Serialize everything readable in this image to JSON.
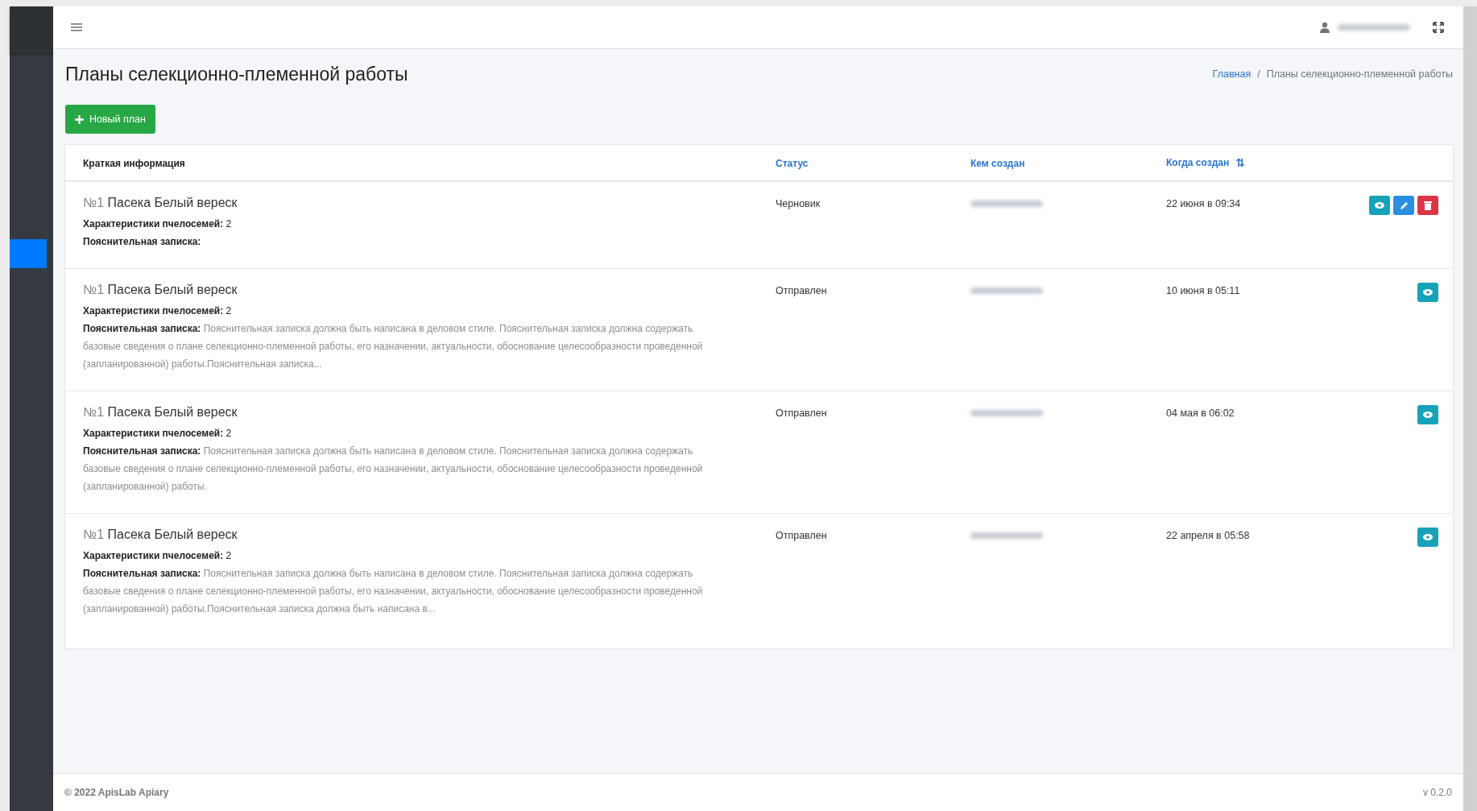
{
  "page_title": "Планы селекционно-племенной работы",
  "breadcrumb_separator": "/",
  "breadcrumb": [
    {
      "label": "Главная",
      "link": true
    },
    {
      "label": "Планы селекционно-племенной работы",
      "link": false
    }
  ],
  "new_button": {
    "label": "Новый план"
  },
  "table": {
    "columns": [
      {
        "label": "Краткая информация",
        "link": false
      },
      {
        "label": "Статус",
        "link": true
      },
      {
        "label": "Кем создан",
        "link": true
      },
      {
        "label": "Когда создан",
        "link": true,
        "sort_icon": "⇅"
      }
    ],
    "rows": [
      {
        "number": "№1",
        "name": "Пасека Белый вереск",
        "traits_label": "Характеристики пчелосемей:",
        "traits": "2",
        "note_label": "Пояснительная записка:",
        "status": "Черновик",
        "date": "22 июня в 09:34",
        "actions": [
          {
            "kind": "view"
          },
          {
            "kind": "edit"
          },
          {
            "kind": "delete"
          }
        ]
      },
      {
        "number": "№1",
        "name": "Пасека Белый вереск",
        "traits_label": "Характеристики пчелосемей:",
        "traits": "2",
        "note_label": "Пояснительная записка:",
        "note": "Пояснительная записка должна быть написана в деловом стиле. Пояснительная записка должна содержать базовые сведения о плане селекционно-племенной работы, его назначении, актуальности, обоснование целесообразности проведенной (запланированной) работы.Пояснительная записка...",
        "status": "Отправлен",
        "date": "10 июня в 05:11",
        "actions": [
          {
            "kind": "view"
          }
        ]
      },
      {
        "number": "№1",
        "name": "Пасека Белый вереск",
        "traits_label": "Характеристики пчелосемей:",
        "traits": "2",
        "note_label": "Пояснительная записка:",
        "note": "Пояснительная записка должна быть написана в деловом стиле. Пояснительная записка должна содержать базовые сведения о плане селекционно-племенной работы, его назначении, актуальности, обоснование целесообразности проведенной (запланированной) работы.",
        "status": "Отправлен",
        "date": "04 мая в 06:02",
        "actions": [
          {
            "kind": "view"
          }
        ]
      },
      {
        "number": "№1",
        "name": "Пасека Белый вереск",
        "traits_label": "Характеристики пчелосемей:",
        "traits": "2",
        "note_label": "Пояснительная записка:",
        "note": "Пояснительная записка должна быть написана в деловом стиле. Пояснительная записка должна содержать базовые сведения о плане селекционно-племенной работы, его назначении, актуальности, обоснование целесообразности проведенной (запланированной) работы.Пояснительная записка должна быть написана в...",
        "status": "Отправлен",
        "date": "22 апреля в 05:58",
        "actions": [
          {
            "kind": "view"
          }
        ]
      }
    ]
  },
  "footer": {
    "copyright": "© 2022 ApisLab Apiary",
    "version": "v 0.2.0"
  }
}
